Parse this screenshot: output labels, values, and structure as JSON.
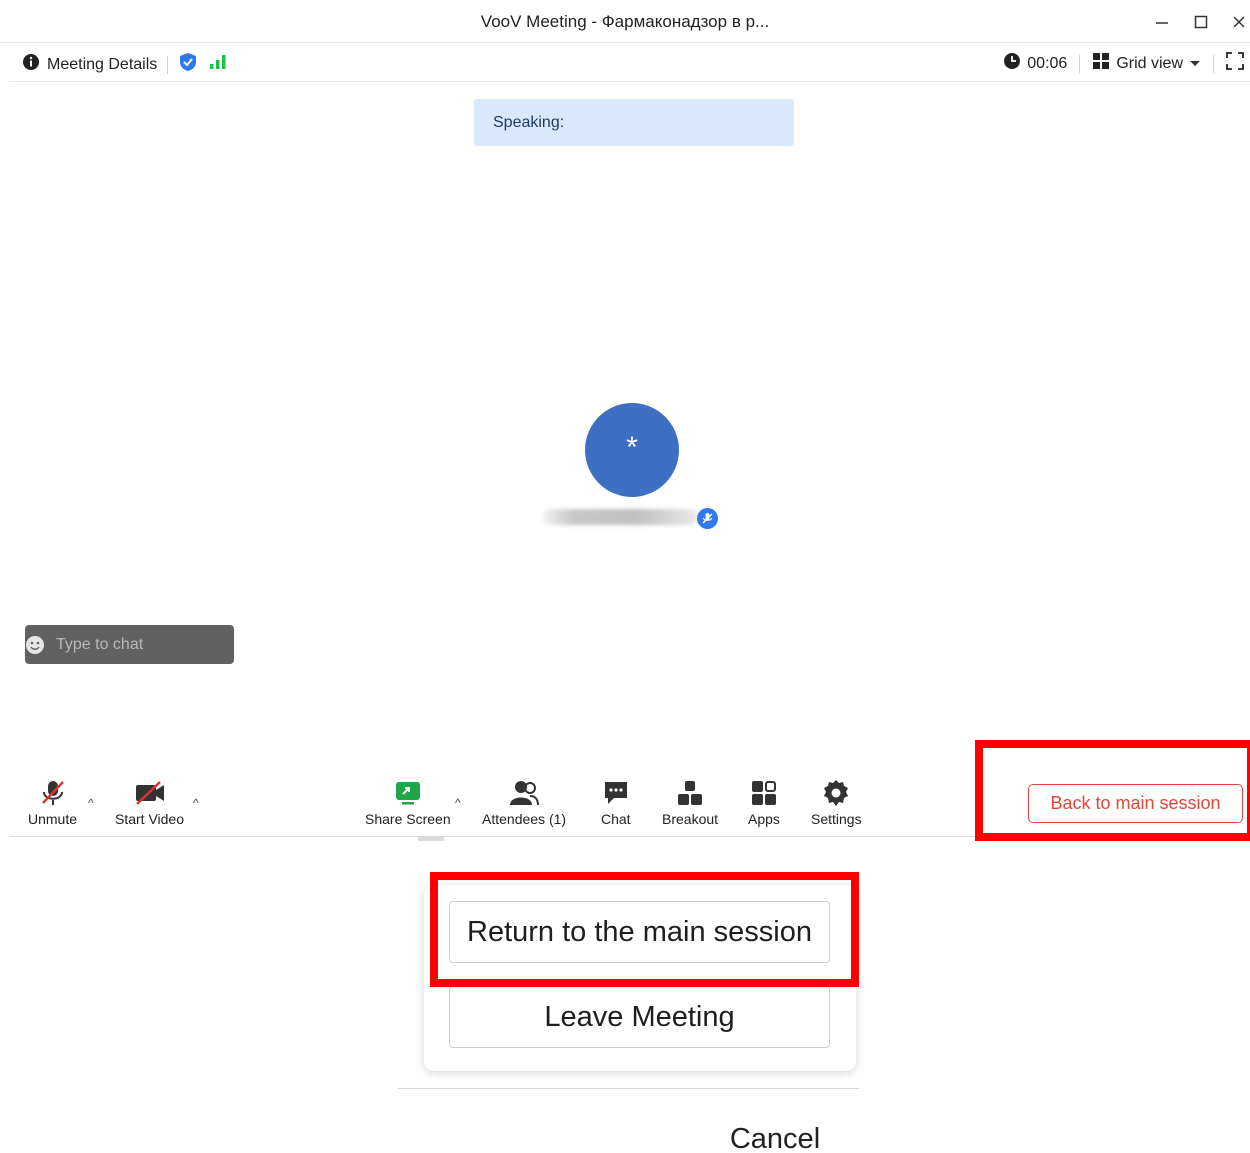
{
  "window": {
    "title": "VooV Meeting - Фармаконадзор в р...",
    "minimize_icon": "minimize-icon",
    "maximize_icon": "maximize-icon",
    "close_icon": "close-icon"
  },
  "infobar": {
    "meeting_details_label": "Meeting Details",
    "security_icon": "shield-check-icon",
    "signal_icon": "signal-bars-icon",
    "timer": "00:06",
    "view_label": "Grid view",
    "fullscreen_icon": "fullscreen-icon"
  },
  "speaking": {
    "label": "Speaking:"
  },
  "participant": {
    "avatar_initial": "*",
    "mic_badge_icon": "mic-muted-badge-icon"
  },
  "chat": {
    "placeholder": "Type to chat",
    "emoji_icon": "emoji-icon",
    "collapse_icon": "chevron-left-icon"
  },
  "toolbar": {
    "unmute_label": "Unmute",
    "start_video_label": "Start Video",
    "share_screen_label": "Share Screen",
    "attendees_label": "Attendees (1)",
    "chat_label": "Chat",
    "breakout_label": "Breakout",
    "apps_label": "Apps",
    "settings_label": "Settings",
    "back_to_main_label": "Back to main session"
  },
  "popup": {
    "return_label": "Return to the main session",
    "leave_label": "Leave Meeting",
    "cancel_label": "Cancel"
  },
  "colors": {
    "accent_red": "#e0473d",
    "highlight_red": "#ff0000",
    "share_green": "#1fa54a",
    "avatar_blue": "#3f6fc3",
    "speaking_bg": "#d9e9fb"
  }
}
